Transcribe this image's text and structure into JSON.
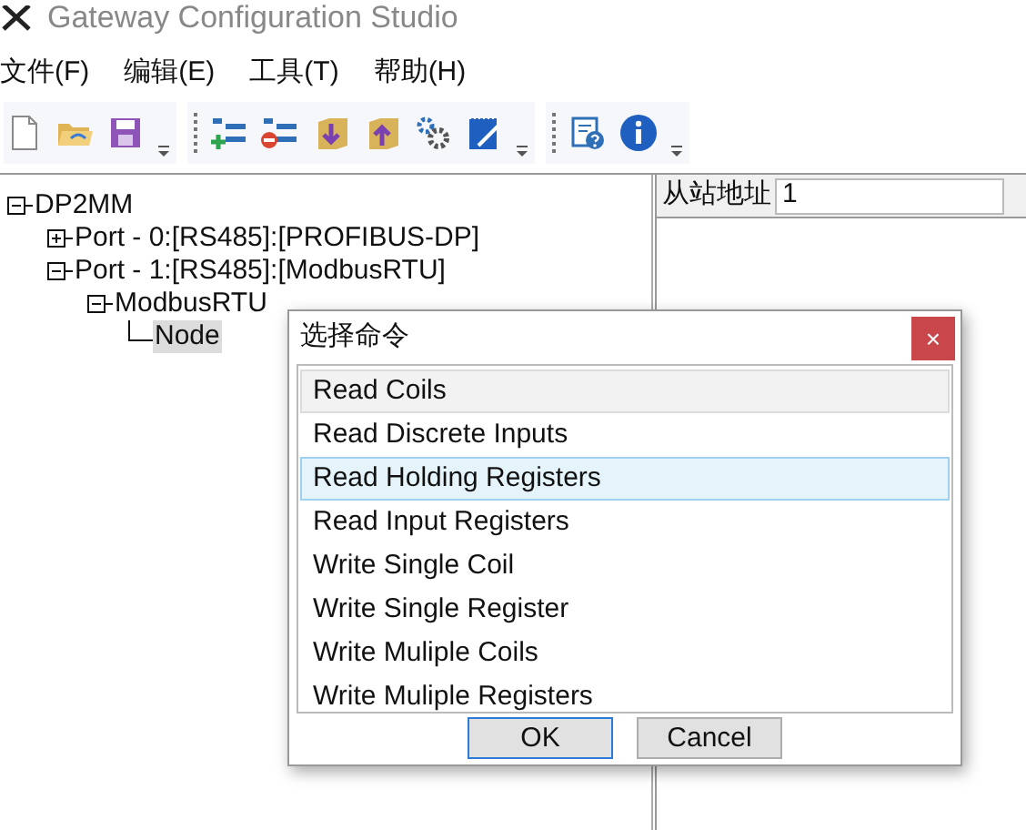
{
  "window": {
    "title": "Gateway Configuration Studio"
  },
  "menu": [
    "文件(F)",
    "编辑(E)",
    "工具(T)",
    "帮助(H)"
  ],
  "tree": [
    {
      "label": "DP2MM",
      "expanded": true,
      "selected": false,
      "children": [
        {
          "label": "Port - 0:[RS485]:[PROFIBUS-DP]",
          "expanded": false,
          "selected": false
        },
        {
          "label": "Port - 1:[RS485]:[ModbusRTU]",
          "expanded": true,
          "selected": false,
          "children": [
            {
              "label": "ModbusRTU",
              "expanded": true,
              "selected": false,
              "children": [
                {
                  "label": "Node",
                  "selected": true
                }
              ]
            }
          ]
        }
      ]
    }
  ],
  "properties": {
    "label": "从站地址",
    "value": "1"
  },
  "dialog": {
    "title": "选择命令",
    "close": "×",
    "items": [
      {
        "label": "Read Coils",
        "highlighted": true,
        "selected": false
      },
      {
        "label": "Read Discrete Inputs",
        "highlighted": false,
        "selected": false
      },
      {
        "label": "Read Holding Registers",
        "highlighted": false,
        "selected": true
      },
      {
        "label": "Read Input Registers",
        "highlighted": false,
        "selected": false
      },
      {
        "label": "Write Single Coil",
        "highlighted": false,
        "selected": false
      },
      {
        "label": "Write Single Register",
        "highlighted": false,
        "selected": false
      },
      {
        "label": "Write Muliple Coils",
        "highlighted": false,
        "selected": false
      },
      {
        "label": "Write Muliple Registers",
        "highlighted": false,
        "selected": false
      }
    ],
    "buttons": [
      {
        "label": "OK",
        "default": true
      },
      {
        "label": "Cancel",
        "default": false
      }
    ]
  }
}
